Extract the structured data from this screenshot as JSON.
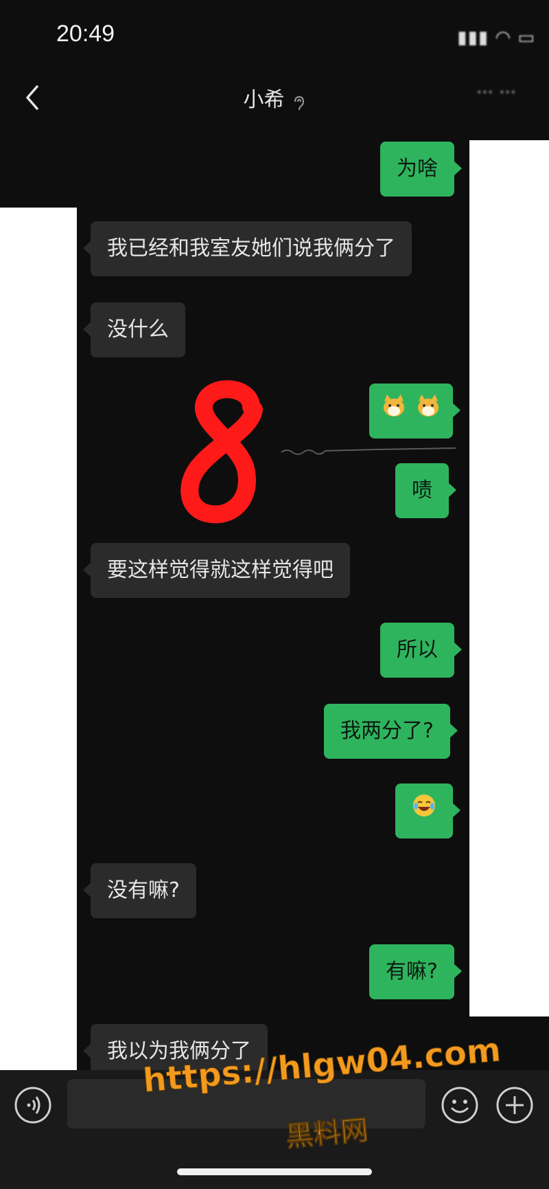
{
  "status_bar": {
    "time": "20:49",
    "icons_text": "::::ıı::ı:ı::ı:ı:ı:ı:ı:ı:ı:ı:ı:ı:ı:ı:ı:ı:ı:ı:ı:ı:ı:ı:ı:ı:ı:ı"
  },
  "header": {
    "title": "小希",
    "more_text": "··· ···"
  },
  "messages": [
    {
      "side": "out",
      "text": "为啥"
    },
    {
      "side": "in",
      "text": "我已经和我室友她们说我俩分了"
    },
    {
      "side": "in",
      "text": "没什么"
    },
    {
      "side": "out",
      "text": "🐱🐱"
    },
    {
      "side": "out",
      "text": "啧"
    },
    {
      "side": "in",
      "text": "要这样觉得就这样觉得吧"
    },
    {
      "side": "out",
      "text": "所以"
    },
    {
      "side": "out",
      "text": "我两分了?"
    },
    {
      "side": "out",
      "text": "😂"
    },
    {
      "side": "in",
      "text": "没有嘛?"
    },
    {
      "side": "out",
      "text": "有嘛?"
    },
    {
      "side": "in",
      "text": "我以为我俩分了"
    }
  ],
  "overlay": {
    "number": "8",
    "color": "#ff1a1a"
  },
  "watermark": {
    "url": "https://hlgw04.com",
    "name": "黑料网"
  },
  "colors": {
    "bubble_out": "#2fb45e",
    "bubble_in": "#2b2b2b",
    "background": "#0e0e0e",
    "watermark": "#f39a1e"
  },
  "icons": {
    "back": "chevron-left-icon",
    "voice": "voice-icon",
    "emoji": "smile-icon",
    "plus": "plus-icon"
  }
}
